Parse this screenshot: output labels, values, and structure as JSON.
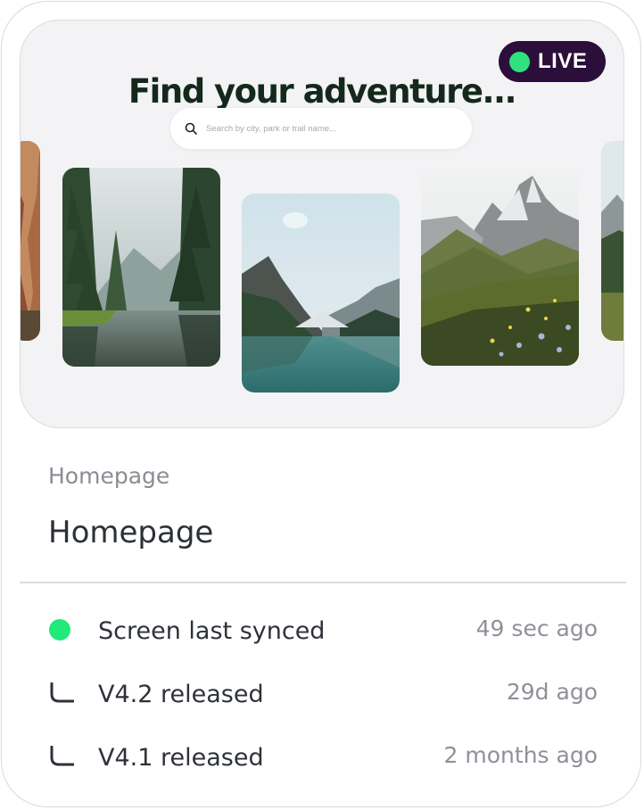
{
  "preview": {
    "headline": "Find your adventure...",
    "live_badge": {
      "label": "LIVE",
      "dot_color": "#2ee37d",
      "bg_color": "#2b0f3a"
    },
    "search": {
      "icon": "search-icon",
      "placeholder": "Search by city, park or trail name..."
    },
    "photos": [
      "desert-canyon-photo",
      "forest-lake-photo",
      "mountain-lake-photo",
      "alpine-meadow-photo",
      "mountain-edge-photo"
    ]
  },
  "screen": {
    "subtitle": "Homepage",
    "title": "Homepage"
  },
  "activity": [
    {
      "label": "Screen last synced",
      "time": "49 sec ago",
      "icon": "sync-status-dot",
      "icon_color": "#21ea7b"
    },
    {
      "label": "V4.2 released",
      "time": "29d ago",
      "icon": "version-branch-icon"
    },
    {
      "label": "V4.1 released",
      "time": "2 months ago",
      "icon": "version-branch-icon"
    }
  ]
}
